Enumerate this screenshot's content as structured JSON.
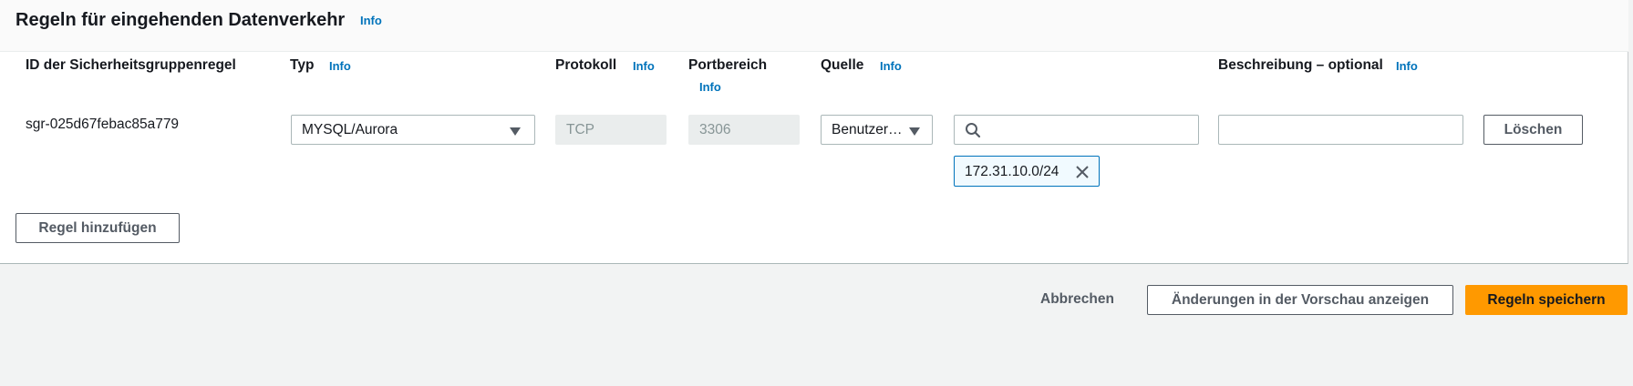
{
  "panel": {
    "title": "Regeln für eingehenden Datenverkehr",
    "info": "Info"
  },
  "columns": {
    "rule_id": "ID der Sicherheitsgruppenregel",
    "type": "Typ",
    "type_info": "Info",
    "protocol": "Protokoll",
    "protocol_info": "Info",
    "port_range": "Portbereich",
    "port_range_info": "Info",
    "source": "Quelle",
    "source_info": "Info",
    "description": "Beschreibung – optional",
    "description_info": "Info"
  },
  "rule": {
    "id": "sgr-025d67febac85a779",
    "type": "MYSQL/Aurora",
    "protocol": "TCP",
    "port": "3306",
    "source_type": "Benutzer…",
    "source_search_value": "",
    "source_token": "172.31.10.0/24",
    "description_value": "",
    "delete_label": "Löschen"
  },
  "add_rule_label": "Regel hinzufügen",
  "footer": {
    "cancel_label": "Abbrechen",
    "preview_label": "Änderungen in der Vorschau anzeigen",
    "save_label": "Regeln speichern"
  },
  "colors": {
    "link": "#0073bb",
    "primary": "#ff9900",
    "token_border": "#0073bb",
    "token_bg": "#f1faff"
  },
  "icons": [
    "caret-down-icon",
    "search-icon",
    "close-icon"
  ]
}
